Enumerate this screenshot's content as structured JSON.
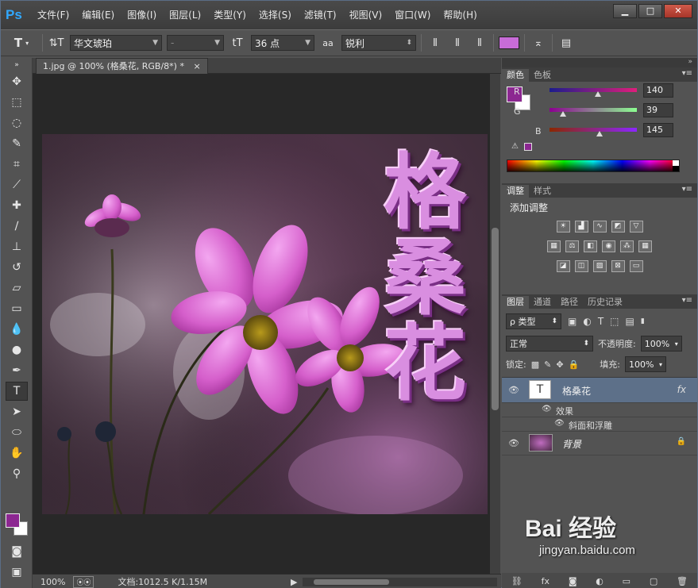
{
  "app": {
    "logo": "Ps"
  },
  "menu": [
    "文件(F)",
    "编辑(E)",
    "图像(I)",
    "图层(L)",
    "类型(Y)",
    "选择(S)",
    "滤镜(T)",
    "视图(V)",
    "窗口(W)",
    "帮助(H)"
  ],
  "window_controls": {
    "minimize": "▁",
    "maximize": "□",
    "close": "✕"
  },
  "options": {
    "tool_glyph": "T",
    "orient_glyph": "⇅T",
    "font_family": "华文琥珀",
    "font_style": "-",
    "size_glyph": "tT",
    "font_size": "36 点",
    "aa_glyph": "aa",
    "antialias": "锐利",
    "text_color": "#c86cd8"
  },
  "doc": {
    "tab_label": "1.jpg @ 100% (格桑花, RGB/8*) *",
    "tab_close": "×",
    "zoom": "100%",
    "doc_info": "文档:1012.5 K/1.15M",
    "text_layer_text": "格桑花"
  },
  "colors": {
    "foreground": "#8c2791",
    "background": "#ffffff"
  },
  "color_panel": {
    "tabs": [
      "颜色",
      "色板"
    ],
    "channels": [
      {
        "label": "R",
        "value": "140",
        "fraction": 0.55,
        "start": "#1c1c8c",
        "end": "#e01e7c"
      },
      {
        "label": "G",
        "value": "39",
        "fraction": 0.15,
        "start": "#8c0091",
        "end": "#8cff91"
      },
      {
        "label": "B",
        "value": "145",
        "fraction": 0.57,
        "start": "#8c2700",
        "end": "#8c27ff"
      }
    ]
  },
  "adjust_panel": {
    "tabs": [
      "调整",
      "样式"
    ],
    "title": "添加调整"
  },
  "layers_panel": {
    "tabs": [
      "图层",
      "通道",
      "路径",
      "历史记录"
    ],
    "filter_kind": "ρ 类型",
    "blend_mode": "正常",
    "opacity_label": "不透明度:",
    "opacity": "100%",
    "lock_label": "锁定:",
    "fill_label": "填充:",
    "fill": "100%",
    "layers": [
      {
        "name": "格桑花",
        "fx": "fx",
        "effects_label": "效果",
        "effect": "斜面和浮雕"
      },
      {
        "name": "背景",
        "lock": "🔒"
      }
    ]
  },
  "watermark": {
    "brand": "Bai 经验",
    "url": "jingyan.baidu.com"
  }
}
